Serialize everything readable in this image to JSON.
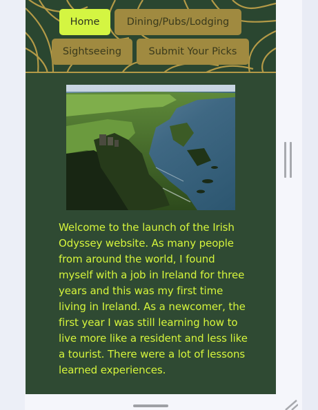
{
  "nav": {
    "items": [
      {
        "label": "Home",
        "active": true
      },
      {
        "label": "Dining/Pubs/Lodging",
        "active": false
      },
      {
        "label": "Sightseeing",
        "active": false
      },
      {
        "label": "Submit Your Picks",
        "active": false
      }
    ]
  },
  "hero": {
    "icon": "coastal-cliff-castle-photo"
  },
  "content": {
    "intro": "Welcome to the launch of the Irish Odyssey website. As many people from around the world, I found myself with a job in Ireland for three years and this was my first time living in Ireland. As a newcomer, the first year I was still learning how to live more like a resident and less like a tourist. There were a lot of lessons learned experiences."
  },
  "colors": {
    "page_bg": "#2f4a33",
    "nav_bg": "#2a4630",
    "nav_gold": "#b49a47",
    "button_inactive": "#a08a40",
    "button_active": "#d4f542",
    "text_accent": "#d6f53c",
    "browser_bg": "#eef1f8"
  }
}
